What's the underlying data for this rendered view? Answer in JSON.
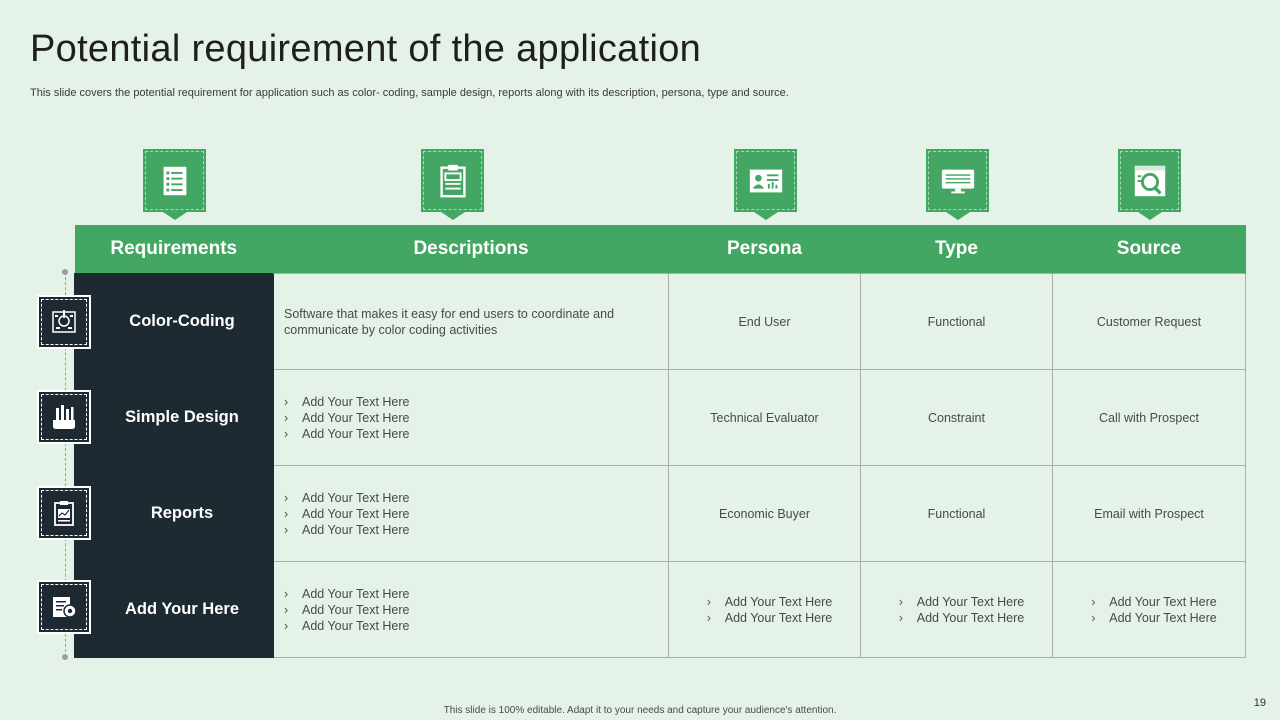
{
  "slide": {
    "title": "Potential requirement of the application",
    "subtitle": "This slide covers the potential requirement for application such as color- coding, sample design, reports along with its description, persona, type and source.",
    "footer": "This slide is 100% editable. Adapt it to your needs and capture your audience's attention.",
    "page_number": "19"
  },
  "colors": {
    "accent": "#44a663",
    "dark": "#1e2a32",
    "background": "#e4f2e7"
  },
  "header_icons": [
    "checklist-icon",
    "clipboard-icon",
    "id-card-icon",
    "monitor-icon",
    "search-report-icon"
  ],
  "row_icons": [
    "palette-icon",
    "design-tools-icon",
    "report-icon",
    "settings-document-icon"
  ],
  "table": {
    "headers": [
      "Requirements",
      "Descriptions",
      "Persona",
      "Type",
      "Source"
    ],
    "rows": [
      {
        "requirement": "Color-Coding",
        "description": "Software that makes it easy for end users to coordinate and communicate by color coding activities",
        "persona": "End User",
        "type": "Functional",
        "source": "Customer Request"
      },
      {
        "requirement": "Simple Design",
        "description_bullets": [
          "Add Your Text Here",
          "Add Your Text Here",
          "Add Your Text Here"
        ],
        "persona": "Technical Evaluator",
        "type": "Constraint",
        "source": "Call with Prospect"
      },
      {
        "requirement": "Reports",
        "description_bullets": [
          "Add Your Text Here",
          "Add Your Text Here",
          "Add Your Text Here"
        ],
        "persona": "Economic Buyer",
        "type": "Functional",
        "source": "Email with Prospect"
      },
      {
        "requirement": "Add Your Here",
        "description_bullets": [
          "Add Your Text Here",
          "Add Your Text Here",
          "Add Your Text Here"
        ],
        "persona_bullets": [
          "Add Your Text Here",
          "Add Your Text Here"
        ],
        "type_bullets": [
          "Add Your Text Here",
          "Add Your Text Here"
        ],
        "source_bullets": [
          "Add Your Text Here",
          "Add Your Text Here"
        ]
      }
    ]
  }
}
